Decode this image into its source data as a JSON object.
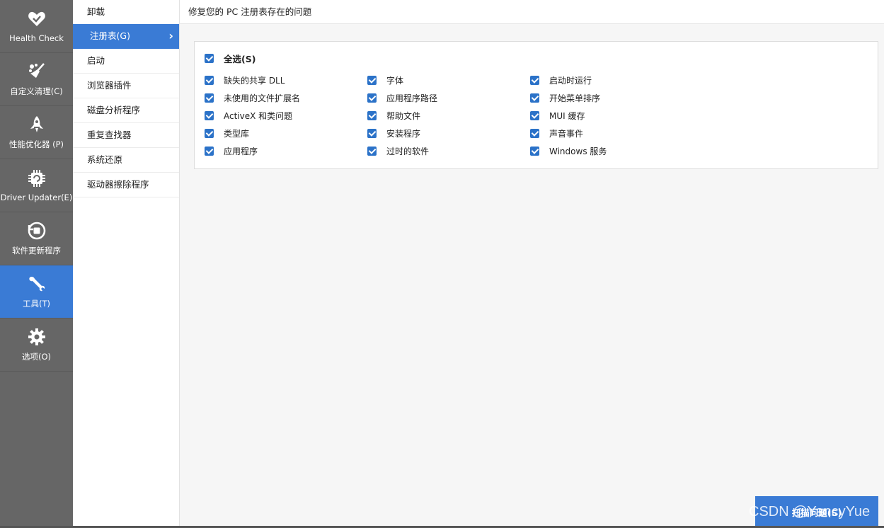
{
  "nav": {
    "items": [
      {
        "label": "Health Check",
        "icon": "heart-icon"
      },
      {
        "label": "自定义清理(C)",
        "icon": "broom-icon"
      },
      {
        "label": "性能优化器 (P)",
        "icon": "rocket-icon"
      },
      {
        "label": "Driver Updater(E)",
        "icon": "chip-icon"
      },
      {
        "label": "软件更新程序",
        "icon": "update-icon"
      },
      {
        "label": "工具(T)",
        "icon": "wrench-icon",
        "active": true
      },
      {
        "label": "选项(O)",
        "icon": "gear-icon"
      }
    ]
  },
  "submenu": {
    "items": [
      {
        "label": "卸载"
      },
      {
        "label": "注册表(G)",
        "active": true
      },
      {
        "label": "启动"
      },
      {
        "label": "浏览器插件"
      },
      {
        "label": "磁盘分析程序"
      },
      {
        "label": "重复查找器"
      },
      {
        "label": "系统还原"
      },
      {
        "label": "驱动器擦除程序"
      }
    ]
  },
  "header": {
    "title": "修复您的 PC 注册表存在的问题"
  },
  "options": {
    "select_all": "全选(S)",
    "columns": [
      [
        "缺失的共享 DLL",
        "未使用的文件扩展名",
        "ActiveX 和类问题",
        "类型库",
        "应用程序"
      ],
      [
        "字体",
        "应用程序路径",
        "帮助文件",
        "安装程序",
        "过时的软件"
      ],
      [
        "启动时运行",
        "开始菜单排序",
        "MUI 缓存",
        "声音事件",
        "Windows 服务"
      ]
    ]
  },
  "actions": {
    "scan_label": "扫描问题(S)"
  },
  "watermark": "CSDN @YancyYue",
  "colors": {
    "accent": "#3a7bd5",
    "sidebar": "#666666",
    "checkbox": "#2b72c8"
  }
}
